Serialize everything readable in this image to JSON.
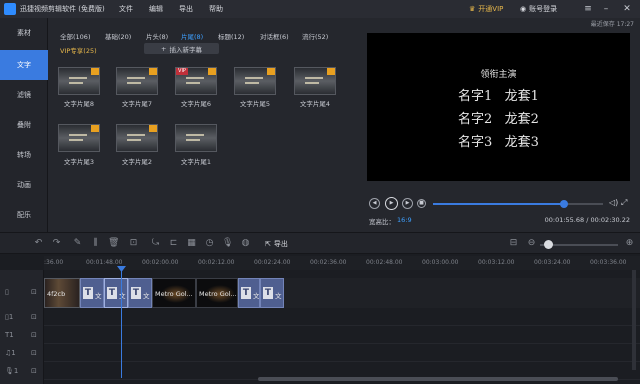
{
  "app": {
    "title": "迅捷视频剪辑软件 (免费版)"
  },
  "menu": [
    "文件",
    "编辑",
    "导出",
    "帮助"
  ],
  "topright": {
    "vip": "开通VIP",
    "login": "账号登录"
  },
  "leftnav": [
    {
      "label": "素材"
    },
    {
      "label": "文字"
    },
    {
      "label": "滤镜"
    },
    {
      "label": "叠附"
    },
    {
      "label": "转场"
    },
    {
      "label": "动画"
    },
    {
      "label": "配乐"
    }
  ],
  "tabs": [
    {
      "label": "全部(106)"
    },
    {
      "label": "基础(20)"
    },
    {
      "label": "片头(8)"
    },
    {
      "label": "片尾(8)"
    },
    {
      "label": "标题(12)"
    },
    {
      "label": "对话框(6)"
    },
    {
      "label": "流行(52)"
    }
  ],
  "vip_tab": "VIP专享(25)",
  "insert_button": "插入新字幕",
  "thumbnails": [
    {
      "label": "文字片尾8"
    },
    {
      "label": "文字片尾7"
    },
    {
      "label": "文字片尾6",
      "vip": "VIP"
    },
    {
      "label": "文字片尾5"
    },
    {
      "label": "文字片尾4"
    },
    {
      "label": "文字片尾3"
    },
    {
      "label": "文字片尾2"
    },
    {
      "label": "文字片尾1"
    }
  ],
  "preview": {
    "autosave": "最近保存 17:27",
    "credits": {
      "heading": "领衔主演",
      "rows": [
        "名字1   龙套1",
        "名字2   龙套2",
        "名字3   龙套3"
      ]
    },
    "ratio_label": "宽高比：",
    "ratio_value": "16:9",
    "timecode": "00:01:55.68 / 00:02:30.22",
    "progress": 0.77
  },
  "toolbar": {
    "export": "导出"
  },
  "timeline": {
    "ticks": [
      ":36.00",
      "00:01:48.00",
      "00:02:00.00",
      "00:02:12.00",
      "00:02:24.00",
      "00:02:36.00",
      "00:02:48.00",
      "00:03:00.00",
      "00:03:12.00",
      "00:03:24.00",
      "00:03:36.00"
    ],
    "clips": [
      {
        "kind": "img",
        "label": "4f2cb"
      },
      {
        "kind": "text",
        "label": "文"
      },
      {
        "kind": "text",
        "label": "文"
      },
      {
        "kind": "text",
        "label": "文"
      },
      {
        "kind": "dark",
        "label": "Metro Gol..."
      },
      {
        "kind": "dark",
        "label": "Metro Gol..."
      },
      {
        "kind": "text",
        "label": "文"
      },
      {
        "kind": "text",
        "label": "文"
      }
    ],
    "zoom": 0.1
  }
}
